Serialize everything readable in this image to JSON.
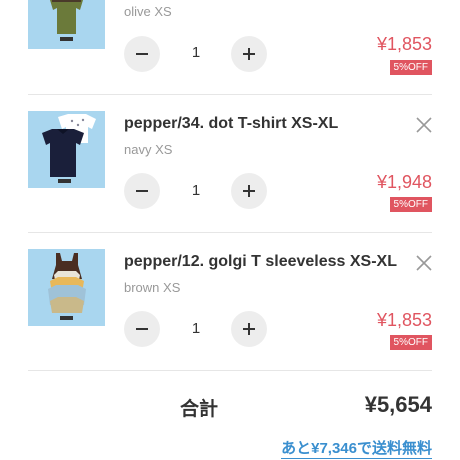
{
  "cart": {
    "items": [
      {
        "name": "",
        "variant": "olive XS",
        "quantity": "1",
        "price": "¥1,853",
        "discount": "5%OFF",
        "thumb_color": "#a9d6ef"
      },
      {
        "name": "pepper/34. dot T-shirt XS-XL",
        "variant": "navy XS",
        "quantity": "1",
        "price": "¥1,948",
        "discount": "5%OFF",
        "thumb_color": "#a9d6ef"
      },
      {
        "name": "pepper/12. golgi T sleeveless XS-XL",
        "variant": "brown XS",
        "quantity": "1",
        "price": "¥1,853",
        "discount": "5%OFF",
        "thumb_color": "#a9d6ef"
      }
    ],
    "icons": {
      "remove": "close-icon",
      "decrement": "minus-icon",
      "increment": "plus-icon"
    }
  },
  "summary": {
    "total_label": "合計",
    "total_value": "¥5,654",
    "free_shipping": "あと¥7,346で送料無料"
  },
  "colors": {
    "price": "#e05560",
    "link": "#3a8fcf",
    "thumb_bg": "#a9d6ef",
    "stepper_bg": "#ededed"
  }
}
